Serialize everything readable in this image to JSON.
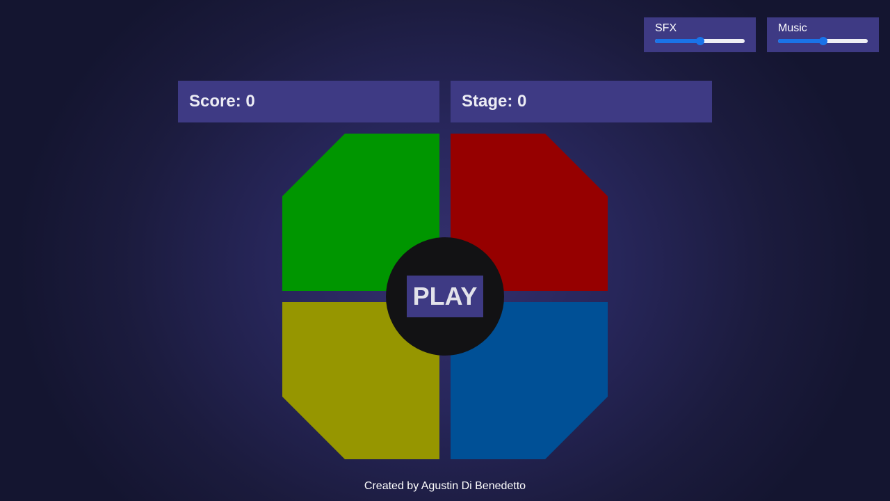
{
  "volume": {
    "sfx": {
      "label": "SFX",
      "level": 0.5
    },
    "music": {
      "label": "Music",
      "level": 0.5
    }
  },
  "stats": {
    "score": "Score: 0",
    "stage": "Stage: 0"
  },
  "board": {
    "pads": [
      {
        "name": "green",
        "color": "#009600"
      },
      {
        "name": "red",
        "color": "#960000"
      },
      {
        "name": "yellow",
        "color": "#969600"
      },
      {
        "name": "blue",
        "color": "#005096"
      }
    ],
    "play_label": "PLAY"
  },
  "footer": {
    "credit": "Created by Agustin Di Benedetto"
  },
  "colors": {
    "panel": "#3e3a84",
    "slider_accent": "#1a73e8",
    "hub": "#121214"
  }
}
